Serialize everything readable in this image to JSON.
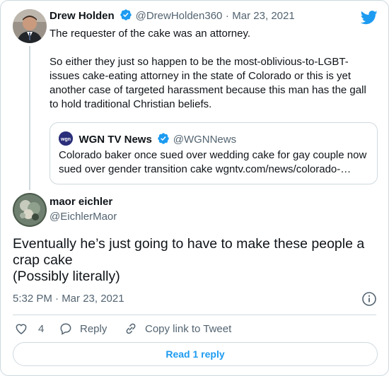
{
  "colors": {
    "accent": "#1d9bf0",
    "text": "#0f1419",
    "muted": "#536471",
    "border": "#cfd9de"
  },
  "parent_tweet": {
    "author_name": "Drew Holden",
    "handle": "@DrewHolden360",
    "separator": "·",
    "date": "Mar 23, 2021",
    "text": "The requester of the cake was an attorney.\n\nSo either they just so happen to be the most-oblivious-to-LGBT-issues cake-eating attorney in the state of Colorado or this is yet another case of targeted harassment because this man has the gall to hold traditional Christian beliefs.",
    "quoted": {
      "author_name": "WGN TV News",
      "handle": "@WGNNews",
      "text": "Colorado baker once sued over wedding cake for gay couple now sued over gender transition cake wgntv.com/news/colorado-…"
    }
  },
  "reply_tweet": {
    "author_name": "maor eichler",
    "handle": "@EichlerMaor",
    "text": "Eventually he’s just going to have to make these people a crap cake\n(Possibly literally)",
    "timestamp": "5:32 PM · Mar 23, 2021",
    "actions": {
      "likes": "4",
      "reply_label": "Reply",
      "copy_label": "Copy link to Tweet"
    },
    "read_replies_label": "Read 1 reply"
  },
  "icons": {
    "brand": "twitter-bird-icon",
    "verified": "verified-badge-icon",
    "info": "info-icon",
    "like": "heart-icon",
    "reply": "reply-bubble-icon",
    "copy": "link-icon"
  }
}
